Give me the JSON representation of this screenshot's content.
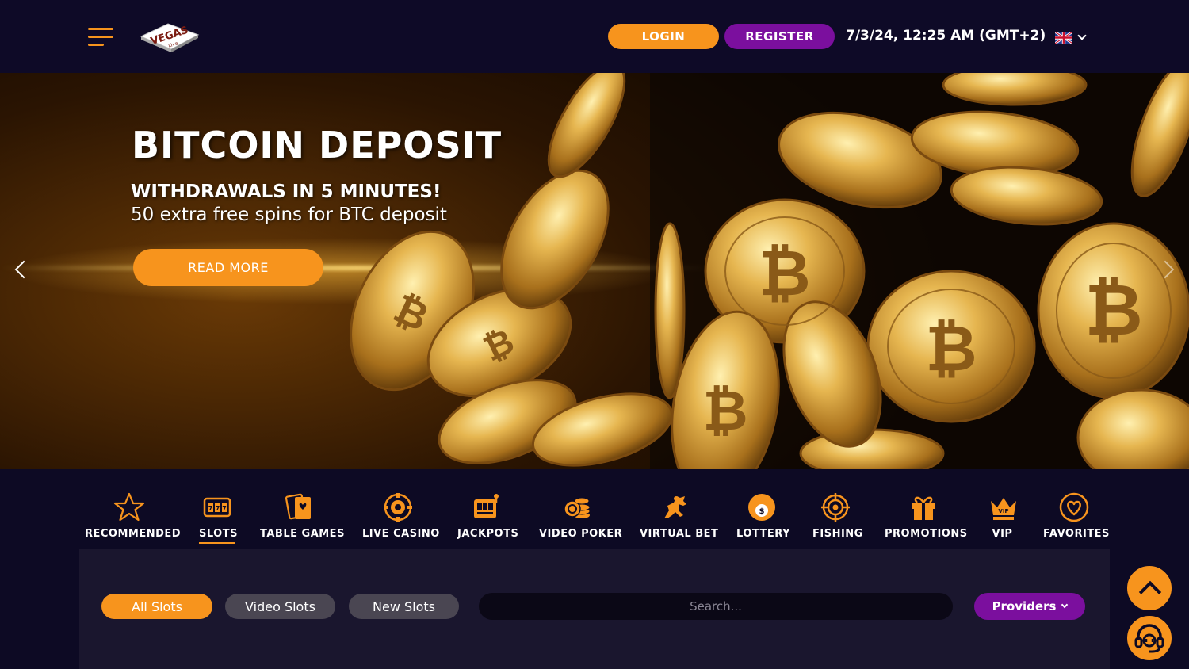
{
  "header": {
    "login_label": "LOGIN",
    "register_label": "REGISTER",
    "datetime": "7/3/24, 12:25 AM (GMT+2)",
    "language_icon": "uk-flag-icon",
    "logo_text": "VEGAS",
    "logo_subtext": "Live"
  },
  "banner": {
    "title": "BITCOIN DEPOSIT",
    "subtitle_line1": "WITHDRAWALS IN 5 MINUTES!",
    "subtitle_line2": "50 extra free spins for BTC deposit",
    "cta_label": "READ MORE"
  },
  "categories": [
    {
      "label": "RECOMMENDED",
      "icon": "star-icon",
      "active": false
    },
    {
      "label": "SLOTS",
      "icon": "slot-machine-icon",
      "active": true
    },
    {
      "label": "TABLE GAMES",
      "icon": "cards-icon",
      "active": false
    },
    {
      "label": "LIVE CASINO",
      "icon": "chip-icon",
      "active": false
    },
    {
      "label": "JACKPOTS",
      "icon": "jackpot-icon",
      "active": false
    },
    {
      "label": "VIDEO POKER",
      "icon": "poker-chips-icon",
      "active": false
    },
    {
      "label": "VIRTUAL BET",
      "icon": "horse-icon",
      "active": false
    },
    {
      "label": "LOTTERY",
      "icon": "lottery-ball-icon",
      "active": false
    },
    {
      "label": "FISHING",
      "icon": "target-icon",
      "active": false
    },
    {
      "label": "PROMOTIONS",
      "icon": "gift-icon",
      "active": false
    },
    {
      "label": "VIP",
      "icon": "crown-icon",
      "active": false
    },
    {
      "label": "FAVORITES",
      "icon": "heart-icon",
      "active": false
    }
  ],
  "filters": {
    "all_slots": "All Slots",
    "video_slots": "Video Slots",
    "new_slots": "New Slots",
    "search_placeholder": "Search...",
    "providers_label": "Providers"
  },
  "colors": {
    "accent_orange": "#f7941d",
    "accent_purple": "#7b0f9e",
    "background": "#0d0a24"
  }
}
